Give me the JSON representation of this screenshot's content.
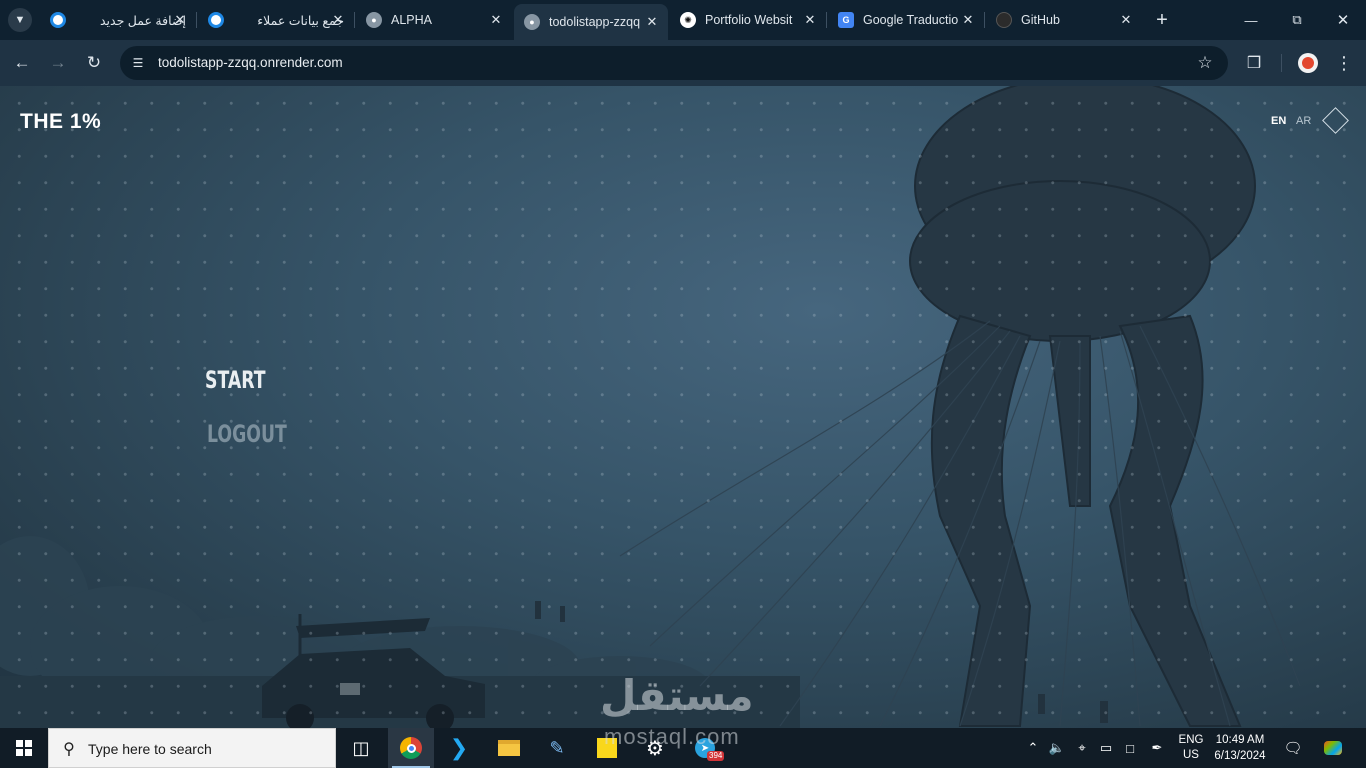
{
  "browser": {
    "tabs": [
      {
        "title": "إضافة عمل جديد",
        "favicon": "blue-ring-icon",
        "favicon_color": "#1e88e5"
      },
      {
        "title": "جمع بيانات عملاء",
        "favicon": "blue-ring-icon",
        "favicon_color": "#1e88e5"
      },
      {
        "title": "ALPHA",
        "favicon": "globe-icon",
        "favicon_color": "#9aa7b2"
      },
      {
        "title": "todolistapp-zzqq",
        "favicon": "globe-icon",
        "favicon_color": "#9aa7b2",
        "active": true
      },
      {
        "title": "Portfolio Websit",
        "favicon": "openai-icon",
        "favicon_color": "#ffffff"
      },
      {
        "title": "Google Traductio",
        "favicon": "google-translate-icon",
        "favicon_color": "#4285f4"
      },
      {
        "title": "GitHub",
        "favicon": "github-icon",
        "favicon_color": "#2b2b2b"
      }
    ],
    "url": "todolistapp-zzqq.onrender.com"
  },
  "page": {
    "brand": "THE 1%",
    "lang_en": "EN",
    "lang_ar": "AR",
    "menu": {
      "start": "START",
      "logout": "LOGOUT"
    },
    "watermark": "مستقل",
    "watermark_sub": "mostaql.com"
  },
  "taskbar": {
    "search_placeholder": "Type here to search",
    "telegram_badge": "394",
    "input_lang_top": "ENG",
    "input_lang_bottom": "US",
    "time": "10:49 AM",
    "date": "6/13/2024"
  },
  "colors": {
    "tabstrip_bg": "#0f2130",
    "toolbar_bg": "#1f3344",
    "page_bg": "#365468",
    "taskbar_bg": "#111c26",
    "telegram_badge": "#d13438"
  }
}
